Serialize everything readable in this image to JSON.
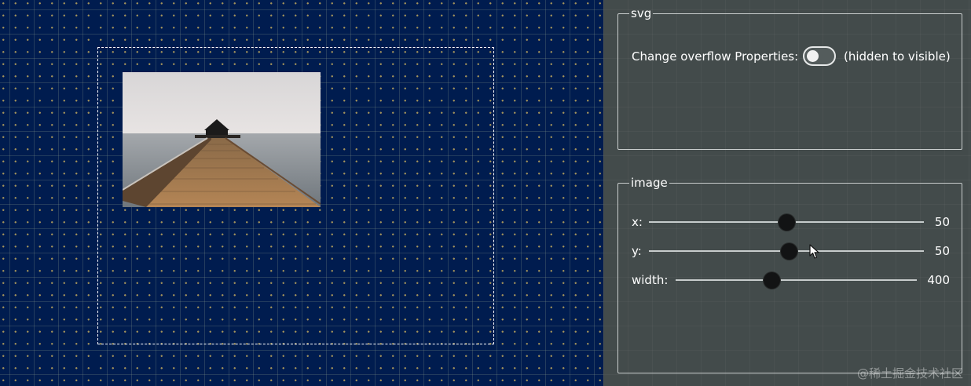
{
  "svg_panel": {
    "legend": "svg",
    "toggle_label": "Change overflow Properties:",
    "toggle_hint": "(hidden to visible)",
    "toggle_on": false
  },
  "image_panel": {
    "legend": "image",
    "sliders": [
      {
        "label": "x:",
        "value": "50"
      },
      {
        "label": "y:",
        "value": "50"
      },
      {
        "label": "width:",
        "value": "400"
      }
    ]
  },
  "watermark": "@稀土掘金技术社区",
  "icons": {
    "image": "pier-photo",
    "cursor": "mouse-pointer-icon"
  }
}
